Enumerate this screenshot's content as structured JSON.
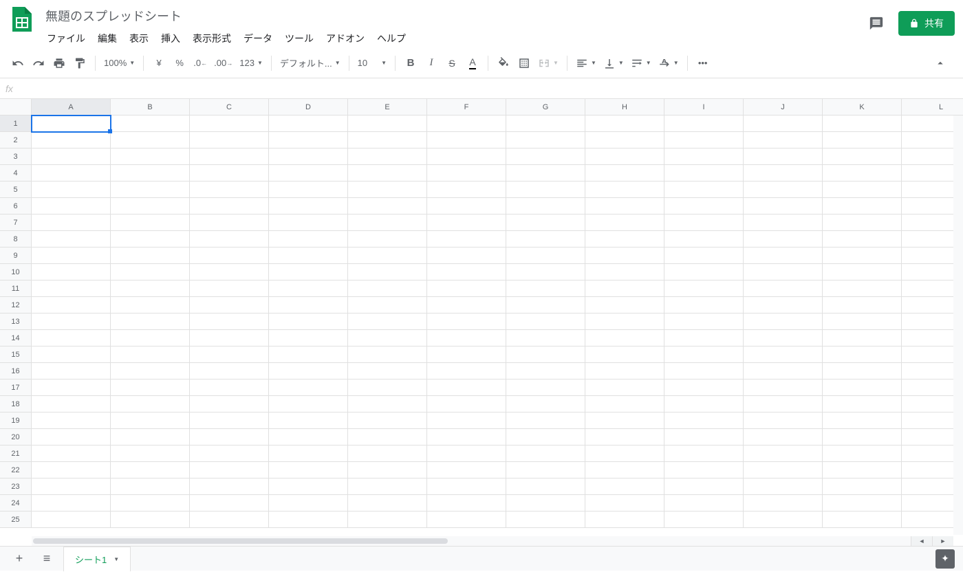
{
  "header": {
    "title": "無題のスプレッドシート",
    "menus": [
      "ファイル",
      "編集",
      "表示",
      "挿入",
      "表示形式",
      "データ",
      "ツール",
      "アドオン",
      "ヘルプ"
    ],
    "share_label": "共有"
  },
  "toolbar": {
    "zoom": "100%",
    "currency": "¥",
    "percent": "%",
    "dec_dec": ".0",
    "inc_dec": ".00",
    "format_num": "123",
    "font": "デフォルト...",
    "font_size": "10",
    "more": "•••"
  },
  "formula": {
    "fx": "fx",
    "value": ""
  },
  "columns": [
    "A",
    "B",
    "C",
    "D",
    "E",
    "F",
    "G",
    "H",
    "I",
    "J",
    "K",
    "L"
  ],
  "row_count": 25,
  "selected": {
    "row": 1,
    "col": "A"
  },
  "sheet_tabs": {
    "active": "シート1"
  }
}
